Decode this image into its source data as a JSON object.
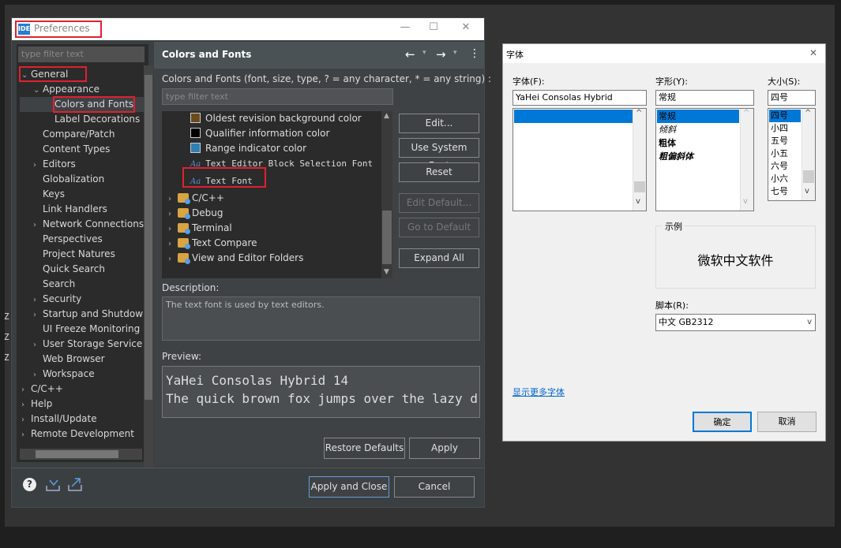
{
  "preferences": {
    "app_badge": "IDE",
    "title": "Preferences",
    "minimize": "—",
    "maximize": "☐",
    "close": "✕",
    "filter_placeholder": "type filter text",
    "tree": [
      {
        "label": "General",
        "expanded": true,
        "indent": 0,
        "expander": "v"
      },
      {
        "label": "Appearance",
        "expanded": true,
        "indent": 1,
        "expander": "v"
      },
      {
        "label": "Colors and Fonts",
        "indent": 2,
        "expander": "",
        "selected": true
      },
      {
        "label": "Label Decorations",
        "indent": 2,
        "expander": ""
      },
      {
        "label": "Compare/Patch",
        "indent": 1,
        "expander": ""
      },
      {
        "label": "Content Types",
        "indent": 1,
        "expander": ""
      },
      {
        "label": "Editors",
        "indent": 1,
        "expander": ">"
      },
      {
        "label": "Globalization",
        "indent": 1,
        "expander": ""
      },
      {
        "label": "Keys",
        "indent": 1,
        "expander": ""
      },
      {
        "label": "Link Handlers",
        "indent": 1,
        "expander": ""
      },
      {
        "label": "Network Connections",
        "indent": 1,
        "expander": ">"
      },
      {
        "label": "Perspectives",
        "indent": 1,
        "expander": ""
      },
      {
        "label": "Project Natures",
        "indent": 1,
        "expander": ""
      },
      {
        "label": "Quick Search",
        "indent": 1,
        "expander": ""
      },
      {
        "label": "Search",
        "indent": 1,
        "expander": ""
      },
      {
        "label": "Security",
        "indent": 1,
        "expander": ">"
      },
      {
        "label": "Startup and Shutdown",
        "indent": 1,
        "expander": ">"
      },
      {
        "label": "UI Freeze Monitoring",
        "indent": 1,
        "expander": ""
      },
      {
        "label": "User Storage Service",
        "indent": 1,
        "expander": ">"
      },
      {
        "label": "Web Browser",
        "indent": 1,
        "expander": ""
      },
      {
        "label": "Workspace",
        "indent": 1,
        "expander": ">"
      },
      {
        "label": "C/C++",
        "indent": 0,
        "expander": ">"
      },
      {
        "label": "Help",
        "indent": 0,
        "expander": ">"
      },
      {
        "label": "Install/Update",
        "indent": 0,
        "expander": ">"
      },
      {
        "label": "Remote Development",
        "indent": 0,
        "expander": ">"
      }
    ],
    "page_title": "Colors and Fonts",
    "nav_back": "←",
    "nav_forward": "→",
    "nav_menu": "⋮",
    "page_description": "Colors and Fonts (font, size, type, ? = any character, * = any string) :",
    "list_filter_placeholder": "type filter text",
    "list_items": [
      {
        "kind": "color",
        "label": "Oldest revision background color",
        "color": "#6b4a1e"
      },
      {
        "kind": "color",
        "label": "Qualifier information color",
        "color": "#000000"
      },
      {
        "kind": "color",
        "label": "Range indicator color",
        "color": "#2f7fb5"
      },
      {
        "kind": "font",
        "label": "Text Editor Block Selection Font",
        "icon": "Aa"
      },
      {
        "kind": "font",
        "label": "Text Font",
        "icon": "Aa",
        "selected": true
      },
      {
        "kind": "folder",
        "label": "C/C++"
      },
      {
        "kind": "folder",
        "label": "Debug"
      },
      {
        "kind": "folder",
        "label": "Terminal"
      },
      {
        "kind": "folder",
        "label": "Text Compare"
      },
      {
        "kind": "folder",
        "label": "View and Editor Folders"
      }
    ],
    "buttons": {
      "edit": "Edit...",
      "use_system_font": "Use System Font",
      "reset": "Reset",
      "edit_default": "Edit Default...",
      "go_to_default": "Go to Default",
      "expand_all": "Expand All",
      "restore_defaults": "Restore Defaults",
      "apply": "Apply",
      "apply_and_close": "Apply and Close",
      "cancel": "Cancel"
    },
    "description_label": "Description:",
    "description_text": "The text font is used by text editors.",
    "preview_label": "Preview:",
    "preview_line1": "YaHei Consolas Hybrid 14",
    "preview_line2": "The quick brown fox jumps over the lazy d",
    "help_icon_glyph": "?"
  },
  "font_dialog": {
    "title": "字体",
    "close": "✕",
    "font_label": "字体(F):",
    "style_label": "字形(Y):",
    "size_label": "大小(S):",
    "font_value": "YaHei Consolas Hybrid",
    "style_value": "常规",
    "size_value": "四号",
    "styles": [
      "常规",
      "倾斜",
      "粗体",
      "粗偏斜体"
    ],
    "sizes": [
      "四号",
      "小四",
      "五号",
      "小五",
      "六号",
      "小六",
      "七号"
    ],
    "sample_label": "示例",
    "sample_text": "微软中文软件",
    "script_label": "脚本(R):",
    "script_value": "中文 GB2312",
    "more_fonts_link": "显示更多字体",
    "ok": "确定",
    "cancel": "取消"
  }
}
